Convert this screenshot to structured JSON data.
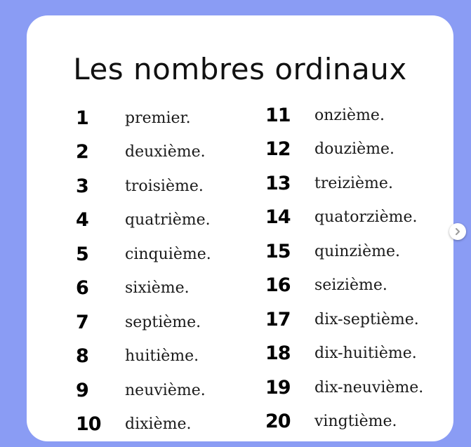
{
  "title": "Les nombres ordinaux",
  "left_column": [
    {
      "number": "1",
      "word": "premier."
    },
    {
      "number": "2",
      "word": "deuxième."
    },
    {
      "number": "3",
      "word": "troisième."
    },
    {
      "number": "4",
      "word": "quatrième."
    },
    {
      "number": "5",
      "word": "cinquième."
    },
    {
      "number": "6",
      "word": "sixième."
    },
    {
      "number": "7",
      "word": "septième."
    },
    {
      "number": "8",
      "word": "huitième."
    },
    {
      "number": "9",
      "word": "neuvième."
    },
    {
      "number": "10",
      "word": "dixième."
    }
  ],
  "right_column": [
    {
      "number": "11",
      "word": "onzième."
    },
    {
      "number": "12",
      "word": "douzième."
    },
    {
      "number": "13",
      "word": "treizième."
    },
    {
      "number": "14",
      "word": "quatorzième."
    },
    {
      "number": "15",
      "word": "quinzième."
    },
    {
      "number": "16",
      "word": "seizième."
    },
    {
      "number": "17",
      "word": "dix-septième."
    },
    {
      "number": "18",
      "word": "dix-huitième."
    },
    {
      "number": "19",
      "word": "dix-neuvième."
    },
    {
      "number": "20",
      "word": "vingtième."
    }
  ],
  "nav": {
    "next_icon": "chevron-right-icon"
  },
  "colors": {
    "background": "#8a9cf4",
    "card": "#ffffff",
    "text": "#000000"
  }
}
